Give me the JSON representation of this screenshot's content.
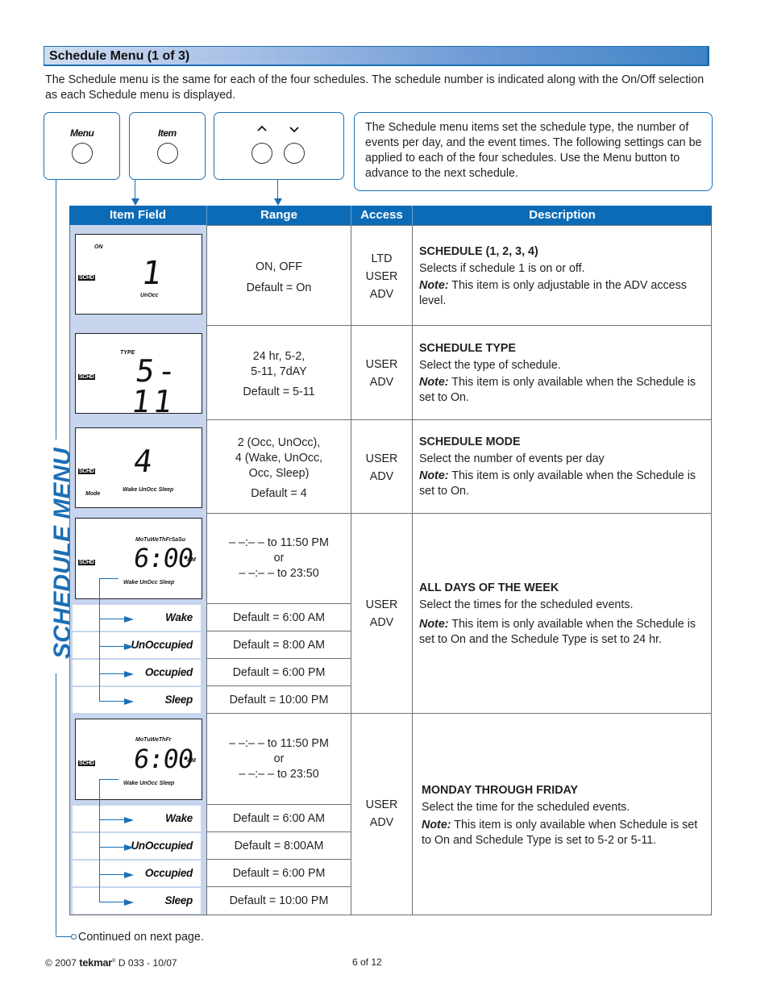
{
  "section": {
    "title": "Schedule Menu (1 of 3)",
    "intro": "The Schedule menu is the same for each of the four schedules. The schedule number is indicated along with the On/Off selection as each Schedule menu is displayed."
  },
  "buttons": {
    "menu_label": "Menu",
    "item_label": "Item",
    "up_glyph": "^",
    "down_glyph": "v"
  },
  "info_box": "The Schedule menu items set the schedule type, the number of events per day, and the event times. The following settings can be applied to each of the four schedules. Use the Menu button to advance to the next schedule.",
  "side_title": "SCHEDULE MENU",
  "table": {
    "headers": [
      "Item Field",
      "Range",
      "Access",
      "Description"
    ],
    "rows": [
      {
        "lcd": {
          "top": "ON",
          "value": "1",
          "bottom": "UnOcc",
          "schd": "SCHD"
        },
        "range": [
          "ON, OFF",
          "Default = On"
        ],
        "access": [
          "LTD",
          "USER",
          "ADV"
        ],
        "desc_title": "SCHEDULE (1, 2, 3, 4)",
        "desc_body": "Selects if schedule 1 is on or off.",
        "note_label": "Note:",
        "note_text": " This item is only adjustable in the ADV access level."
      },
      {
        "lcd": {
          "top": "TYPE",
          "value": "5-11",
          "schd": "SCHD"
        },
        "range": [
          "24 hr, 5-2,",
          "5-11, 7dAY",
          "Default = 5-11"
        ],
        "access": [
          "USER",
          "ADV"
        ],
        "desc_title": "SCHEDULE TYPE",
        "desc_body": "Select the type of schedule.",
        "note_label": "Note:",
        "note_text": " This item is only available when the Schedule is set to On."
      },
      {
        "lcd": {
          "value": "4",
          "bottom": "Wake UnOcc Sleep",
          "mode": "Mode",
          "schd": "SCHD"
        },
        "range": [
          "2 (Occ, UnOcc),",
          "4 (Wake, UnOcc,",
          "Occ, Sleep)",
          "Default = 4"
        ],
        "access": [
          "USER",
          "ADV"
        ],
        "desc_title": "SCHEDULE MODE",
        "desc_body": "Select the number of events per day",
        "note_label": "Note:",
        "note_text": " This item is only available when the Schedule is set to On."
      },
      {
        "lcd": {
          "days": "MoTuWeThFrSaSu",
          "value": "6:00",
          "ampm": "AM",
          "bottom": "Wake UnOcc Sleep",
          "schd": "SCHD"
        },
        "range": [
          "– –:– – to 11:50 PM",
          "or",
          "– –:– – to 23:50"
        ],
        "access": [
          "USER",
          "ADV"
        ],
        "events": [
          {
            "label": "Wake",
            "default": "Default = 6:00 AM"
          },
          {
            "label": "UnOccupied",
            "default": "Default = 8:00 AM"
          },
          {
            "label": "Occupied",
            "default": "Default = 6:00 PM"
          },
          {
            "label": "Sleep",
            "default": "Default = 10:00 PM"
          }
        ],
        "desc_title": "ALL DAYS OF THE WEEK",
        "desc_body": "Select the times for the scheduled events.",
        "note_label": "Note:",
        "note_text": " This item is only available when the Schedule is set to On and the Schedule Type is set to 24 hr."
      },
      {
        "lcd": {
          "days": "MoTuWeThFr",
          "value": "6:00",
          "ampm": "AM",
          "bottom": "Wake UnOcc Sleep",
          "schd": "SCHD"
        },
        "range": [
          "– –:– – to 11:50 PM",
          "or",
          "– –:– – to 23:50"
        ],
        "access": [
          "USER",
          "ADV"
        ],
        "events": [
          {
            "label": "Wake",
            "default": "Default = 6:00 AM"
          },
          {
            "label": "UnOccupied",
            "default": "Default = 8:00AM"
          },
          {
            "label": "Occupied",
            "default": "Default = 6:00 PM"
          },
          {
            "label": "Sleep",
            "default": "Default = 10:00 PM"
          }
        ],
        "desc_title": "MONDAY THROUGH FRIDAY",
        "desc_body": "Select the time for the scheduled events.",
        "note_label": "Note:",
        "note_text": " This item is only available when Schedule is set to On and Schedule Type is set to 5-2 or 5-11."
      }
    ]
  },
  "continued": "Continued on next page.",
  "footer": {
    "copyright": "© 2007",
    "brand": "tekmar",
    "reg": "®",
    "doc": "D 033 - 10/07",
    "page": "6 of 12"
  },
  "colors": {
    "accent_blue": "#1a6fb5",
    "header_blue": "#0c6bb6",
    "field_bg": "#c7d5ee"
  }
}
